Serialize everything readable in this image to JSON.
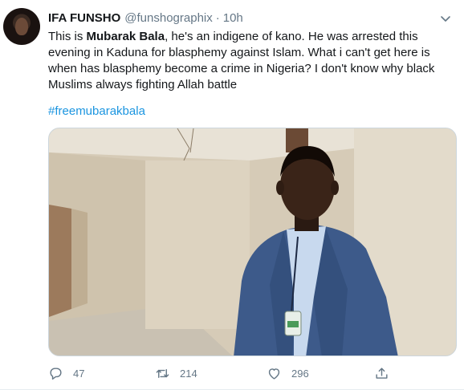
{
  "tweet": {
    "author_name": "IFA FUNSHO",
    "handle": "@funshographix",
    "separator": "·",
    "time": "10h",
    "text_intro": "This is ",
    "text_bold": "Mubarak Bala",
    "text_rest": ", he's an indigene of kano. He was arrested this evening in Kaduna for blasphemy against Islam. What i can't get here is when has blasphemy become a crime in Nigeria? I don't know why black Muslims always fighting Allah battle",
    "hashtag": "#freemubarakbala"
  },
  "actions": {
    "replies": "47",
    "retweets": "214",
    "likes": "296"
  },
  "icons": {
    "reply": "reply-icon",
    "retweet": "retweet-icon",
    "like": "heart-icon",
    "share": "share-icon",
    "caret": "chevron-down-icon"
  },
  "colors": {
    "link": "#1b95e0",
    "muted": "#657786",
    "suit": "#3d5a8a"
  }
}
